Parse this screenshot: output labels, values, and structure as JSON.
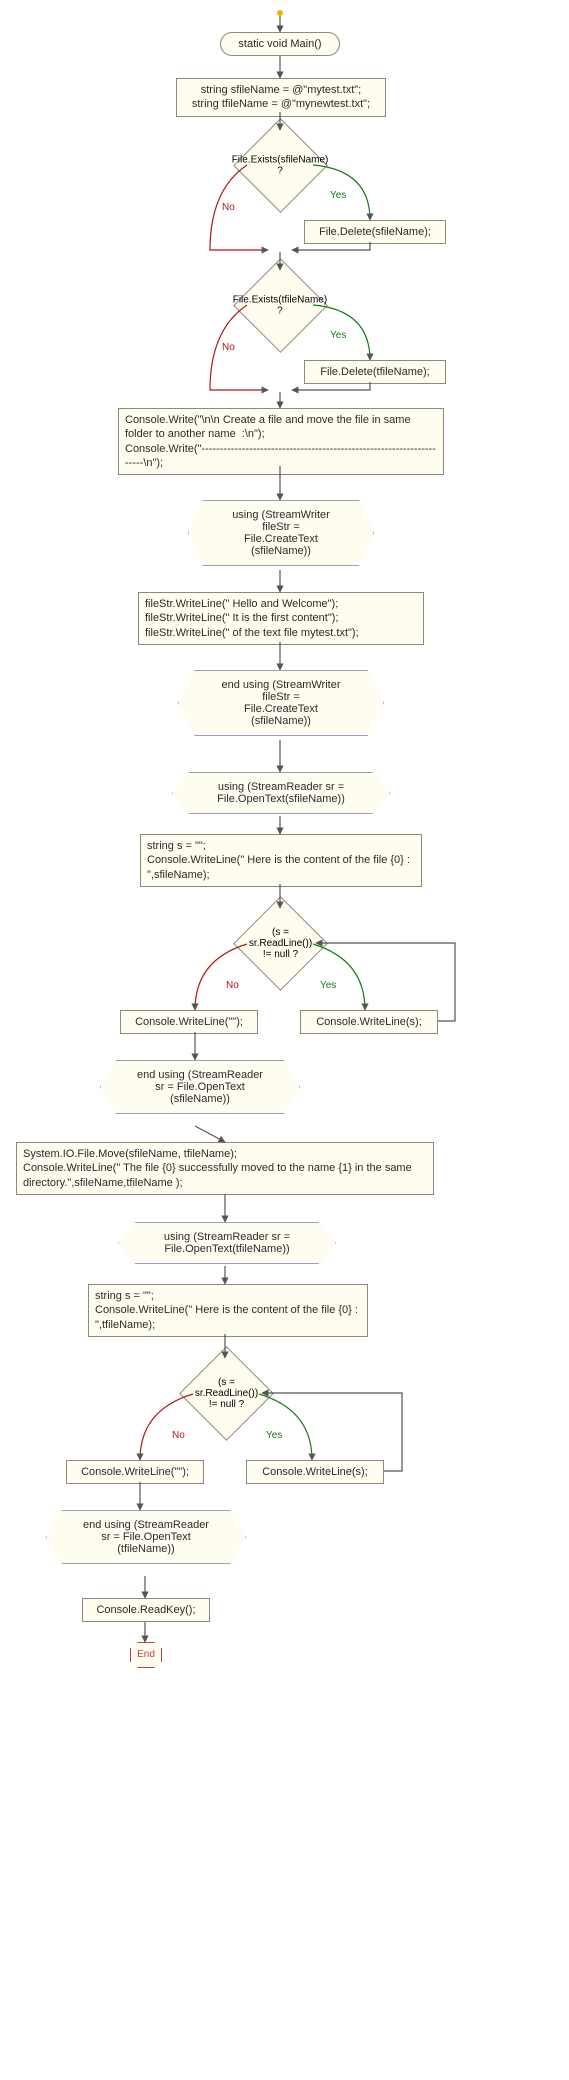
{
  "flow": {
    "n_start": "static void Main()",
    "n_decl": "string sfileName = @\"mytest.txt\";\nstring tfileName = @\"mynewtest.txt\";",
    "d_exists_s": "File.Exists(sfileName) ?",
    "n_delete_s": "File.Delete(sfileName);",
    "d_exists_t": "File.Exists(tfileName) ?",
    "n_delete_t": "File.Delete(tfileName);",
    "n_header": "Console.Write(\"\\n\\n Create a file and move the file in same folder to another name  :\\n\");\nConsole.Write(\"---------------------------------------------------------------------\\n\");",
    "h_using_sw": "using (StreamWriter\nfileStr =\nFile.CreateText\n(sfileName))",
    "n_write_lines": "fileStr.WriteLine(\" Hello and Welcome\");\nfileStr.WriteLine(\" It is the first content\");\nfileStr.WriteLine(\" of the text file mytest.txt\");",
    "h_endusing_sw": "end using (StreamWriter\nfileStr =\nFile.CreateText\n(sfileName))",
    "h_using_sr1": "using (StreamReader sr =\nFile.OpenText(sfileName))",
    "n_readprep1": "string s = \"\";\nConsole.WriteLine(\" Here is the content of the file {0} : \",sfileName);",
    "d_read1": "(s = sr.ReadLine())\n!= null ?",
    "n_read1_yes": "Console.WriteLine(s);",
    "n_read1_no": "Console.WriteLine(\"\");",
    "h_endusing_sr1": "end using (StreamReader\nsr = File.OpenText\n(sfileName))",
    "n_move": "System.IO.File.Move(sfileName, tfileName);\nConsole.WriteLine(\" The file {0} successfully moved to the name {1} in the same directory.\",sfileName,tfileName );",
    "h_using_sr2": "using (StreamReader sr =\nFile.OpenText(tfileName))",
    "n_readprep2": "string s = \"\";\nConsole.WriteLine(\" Here is the content of the file {0} : \",tfileName);",
    "d_read2": "(s = sr.ReadLine())\n!= null ?",
    "n_read2_yes": "Console.WriteLine(s);",
    "n_read2_no": "Console.WriteLine(\"\");",
    "h_endusing_sr2": "end using (StreamReader\nsr = File.OpenText\n(tfileName))",
    "n_readkey": "Console.ReadKey();",
    "n_end": "End",
    "yes": "Yes",
    "no": "No"
  }
}
